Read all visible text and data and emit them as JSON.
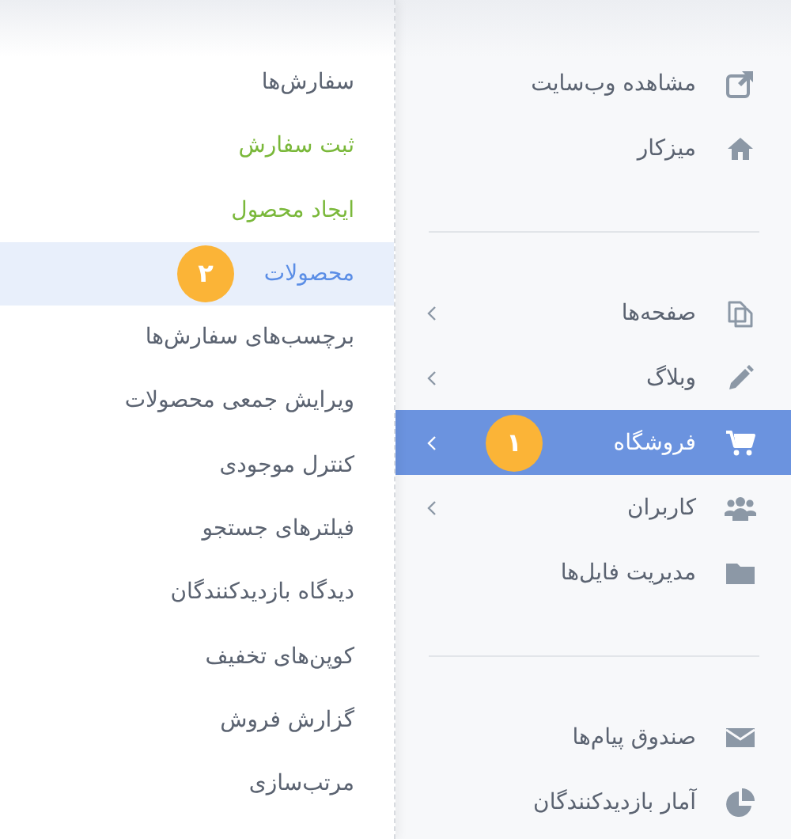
{
  "sidebar": {
    "sections": [
      {
        "items": [
          {
            "label": "مشاهده وب‌سایت",
            "selected": false,
            "expandable": false
          },
          {
            "label": "میزکار",
            "selected": false,
            "expandable": false
          }
        ]
      },
      {
        "items": [
          {
            "label": "صفحه‌ها",
            "selected": false,
            "expandable": true
          },
          {
            "label": "وبلاگ",
            "selected": false,
            "expandable": true
          },
          {
            "label": "فروشگاه",
            "selected": true,
            "expandable": true,
            "badge": "۱"
          },
          {
            "label": "کاربران",
            "selected": false,
            "expandable": true
          },
          {
            "label": "مدیریت فایل‌ها",
            "selected": false,
            "expandable": false
          }
        ]
      },
      {
        "items": [
          {
            "label": "صندوق پیام‌ها",
            "selected": false,
            "expandable": false
          },
          {
            "label": "آمار بازدیدکنندگان",
            "selected": false,
            "expandable": false
          }
        ]
      }
    ]
  },
  "submenu": {
    "items": [
      {
        "label": "سفارش‌ها",
        "kind": "link",
        "selected": false
      },
      {
        "label": "ثبت سفارش",
        "kind": "action",
        "selected": false
      },
      {
        "label": "ایجاد محصول",
        "kind": "action",
        "selected": false
      },
      {
        "label": "محصولات",
        "kind": "link",
        "selected": true,
        "badge": "۲"
      },
      {
        "label": "برچسب‌های سفارش‌ها",
        "kind": "link",
        "selected": false
      },
      {
        "label": "ویرایش جمعی محصولات",
        "kind": "link",
        "selected": false
      },
      {
        "label": "کنترل موجودی",
        "kind": "link",
        "selected": false
      },
      {
        "label": "فیلترهای جستجو",
        "kind": "link",
        "selected": false
      },
      {
        "label": "دیدگاه بازدیدکنندگان",
        "kind": "link",
        "selected": false
      },
      {
        "label": "کوپن‌های تخفیف",
        "kind": "link",
        "selected": false
      },
      {
        "label": "گزارش فروش",
        "kind": "link",
        "selected": false
      },
      {
        "label": "مرتب‌سازی",
        "kind": "link",
        "selected": false
      }
    ]
  }
}
